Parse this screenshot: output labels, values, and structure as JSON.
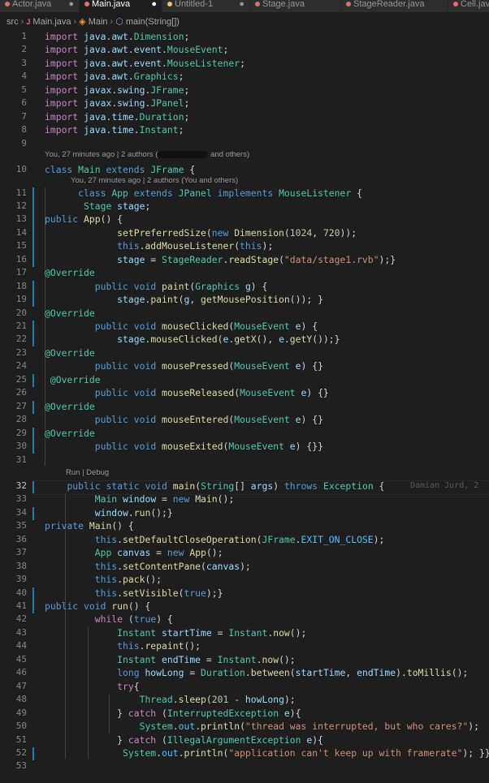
{
  "tabs": [
    {
      "label": "Actor.java",
      "modified": true,
      "active": false
    },
    {
      "label": "Main.java",
      "modified": true,
      "active": true
    },
    {
      "label": "Untitled-1",
      "modified": true,
      "active": false
    },
    {
      "label": "Stage.java",
      "modified": false,
      "active": false
    },
    {
      "label": "StageReader.java",
      "modified": false,
      "active": false
    },
    {
      "label": "Cell.java",
      "modified": false,
      "active": false
    }
  ],
  "breadcrumb": {
    "root": "src",
    "file": "Main.java",
    "class": "Main",
    "method": "main(String[])"
  },
  "lens": {
    "blame_main": "You, 27 minutes ago | 2 authors (",
    "blame_main_tail": " and others)",
    "blame_app": "You, 27 minutes ago | 2 authors (You and others)",
    "run_debug": "Run | Debug"
  },
  "inline_blame": "Damian Jurd, 2",
  "lines": [
    {
      "n": "1",
      "html": "<span class='kc'>import</span> <span class='v'>java</span>.<span class='v'>awt</span>.<span class='t'>Dimension</span>;"
    },
    {
      "n": "2",
      "html": "<span class='kc'>import</span> <span class='v'>java</span>.<span class='v'>awt</span>.<span class='v'>event</span>.<span class='t'>MouseEvent</span>;"
    },
    {
      "n": "3",
      "html": "<span class='kc'>import</span> <span class='v'>java</span>.<span class='v'>awt</span>.<span class='v'>event</span>.<span class='t'>MouseListener</span>;"
    },
    {
      "n": "4",
      "html": "<span class='kc'>import</span> <span class='v'>java</span>.<span class='v'>awt</span>.<span class='t'>Graphics</span>;"
    },
    {
      "n": "5",
      "html": "<span class='kc'>import</span> <span class='v'>javax</span>.<span class='v'>swing</span>.<span class='t'>JFrame</span>;"
    },
    {
      "n": "6",
      "html": "<span class='kc'>import</span> <span class='v'>javax</span>.<span class='v'>swing</span>.<span class='t'>JPanel</span>;"
    },
    {
      "n": "7",
      "html": "<span class='kc'>import</span> <span class='v'>java</span>.<span class='v'>time</span>.<span class='t'>Duration</span>;"
    },
    {
      "n": "8",
      "html": "<span class='kc'>import</span> <span class='v'>java</span>.<span class='v'>time</span>.<span class='t'>Instant</span>;"
    },
    {
      "n": "9",
      "html": ""
    },
    {
      "n": "10",
      "html": "<span class='k'>class</span> <span class='t'>Main</span> <span class='k'>extends</span> <span class='t'>JFrame</span> {"
    },
    {
      "n": "11",
      "html": "      <span class='k'>class</span> <span class='t'>App</span> <span class='k'>extends</span> <span class='t'>JPanel</span> <span class='k'>implements</span> <span class='t'>MouseListener</span> {"
    },
    {
      "n": "12",
      "html": "       <span class='t'>Stage</span> <span class='v'>stage</span>;"
    },
    {
      "n": "13",
      "html": "<span class='k'>public</span> <span class='f'>App</span>() {"
    },
    {
      "n": "14",
      "html": "             <span class='f'>setPreferredSize</span>(<span class='k'>new</span> <span class='f'>Dimension</span>(<span class='n'>1024</span>, <span class='n'>720</span>));"
    },
    {
      "n": "15",
      "html": "             <span class='k'>this</span>.<span class='f'>addMouseListener</span>(<span class='k'>this</span>);"
    },
    {
      "n": "16",
      "html": "             <span class='v'>stage</span> = <span class='t'>StageReader</span>.<span class='f'>readStage</span>(<span class='s'>\"data/stage1.rvb\"</span>);}"
    },
    {
      "n": "17",
      "html": "<span class='ann'>@Override</span>"
    },
    {
      "n": "18",
      "html": "         <span class='k'>public</span> <span class='k'>void</span> <span class='f'>paint</span>(<span class='t'>Graphics</span> <span class='v'>g</span>) {"
    },
    {
      "n": "19",
      "html": "             <span class='v'>stage</span>.<span class='f'>paint</span>(<span class='v'>g</span>, <span class='f'>getMousePosition</span>()); }"
    },
    {
      "n": "20",
      "html": "<span class='ann'>@Override</span>"
    },
    {
      "n": "21",
      "html": "         <span class='k'>public</span> <span class='k'>void</span> <span class='f'>mouseClicked</span>(<span class='t'>MouseEvent</span> <span class='v'>e</span>) {"
    },
    {
      "n": "22",
      "html": "             <span class='v'>stage</span>.<span class='f'>mouseClicked</span>(<span class='v'>e</span>.<span class='f'>getX</span>(), <span class='v'>e</span>.<span class='f'>getY</span>());}"
    },
    {
      "n": "23",
      "html": "<span class='ann'>@Override</span>"
    },
    {
      "n": "24",
      "html": "         <span class='k'>public</span> <span class='k'>void</span> <span class='f'>mousePressed</span>(<span class='t'>MouseEvent</span> <span class='v'>e</span>) {}"
    },
    {
      "n": "25",
      "html": " <span class='ann'>@Override</span>"
    },
    {
      "n": "26",
      "html": "         <span class='k'>public</span> <span class='k'>void</span> <span class='f'>mouseReleased</span>(<span class='t'>MouseEvent</span> <span class='v'>e</span>) {}"
    },
    {
      "n": "27",
      "html": "<span class='ann'>@Override</span>"
    },
    {
      "n": "28",
      "html": "         <span class='k'>public</span> <span class='k'>void</span> <span class='f'>mouseEntered</span>(<span class='t'>MouseEvent</span> <span class='v'>e</span>) {}"
    },
    {
      "n": "29",
      "html": "<span class='ann'>@Override</span>"
    },
    {
      "n": "30",
      "html": "         <span class='k'>public</span> <span class='k'>void</span> <span class='f'>mouseExited</span>(<span class='t'>MouseEvent</span> <span class='v'>e</span>) {}}"
    },
    {
      "n": "31",
      "html": ""
    },
    {
      "n": "32",
      "html": "    <span class='k'>public</span> <span class='k'>static</span> <span class='k'>void</span> <span class='f'>main</span>(<span class='t'>String</span>[] <span class='v'>args</span>) <span class='k'>throws</span> <span class='t'>Exception</span> {"
    },
    {
      "n": "33",
      "html": "         <span class='t'>Main</span> <span class='v'>window</span> = <span class='k'>new</span> <span class='f'>Main</span>();"
    },
    {
      "n": "34",
      "html": "         <span class='v'>window</span>.<span class='f'>run</span>();}"
    },
    {
      "n": "35",
      "html": "<span class='k'>private</span> <span class='f'>Main</span>() {"
    },
    {
      "n": "36",
      "html": "         <span class='k'>this</span>.<span class='f'>setDefaultCloseOperation</span>(<span class='t'>JFrame</span>.<span class='m'>EXIT_ON_CLOSE</span>);"
    },
    {
      "n": "37",
      "html": "         <span class='t'>App</span> <span class='v'>canvas</span> = <span class='k'>new</span> <span class='f'>App</span>();"
    },
    {
      "n": "38",
      "html": "         <span class='k'>this</span>.<span class='f'>setContentPane</span>(<span class='v'>canvas</span>);"
    },
    {
      "n": "39",
      "html": "         <span class='k'>this</span>.<span class='f'>pack</span>();"
    },
    {
      "n": "40",
      "html": "         <span class='k'>this</span>.<span class='f'>setVisible</span>(<span class='k'>true</span>);}"
    },
    {
      "n": "41",
      "html": "<span class='k'>public</span> <span class='k'>void</span> <span class='f'>run</span>() {"
    },
    {
      "n": "42",
      "html": "         <span class='kc'>while</span> (<span class='k'>true</span>) {"
    },
    {
      "n": "43",
      "html": "             <span class='t'>Instant</span> <span class='v'>startTime</span> = <span class='t'>Instant</span>.<span class='f'>now</span>();"
    },
    {
      "n": "44",
      "html": "             <span class='k'>this</span>.<span class='f'>repaint</span>();"
    },
    {
      "n": "45",
      "html": "             <span class='t'>Instant</span> <span class='v'>endTime</span> = <span class='t'>Instant</span>.<span class='f'>now</span>();"
    },
    {
      "n": "46",
      "html": "             <span class='k'>long</span> <span class='v'>howLong</span> = <span class='t'>Duration</span>.<span class='f'>between</span>(<span class='v'>startTime</span>, <span class='v'>endTime</span>).<span class='f'>toMillis</span>();"
    },
    {
      "n": "47",
      "html": "             <span class='kc'>try</span>{"
    },
    {
      "n": "48",
      "html": "                 <span class='t'>Thread</span>.<span class='f'>sleep</span>(<span class='n'>201</span> - <span class='v'>howLong</span>);"
    },
    {
      "n": "49",
      "html": "             } <span class='kc'>catch</span> (<span class='t'>InterruptedException</span> <span class='v'>e</span>){"
    },
    {
      "n": "50",
      "html": "                 <span class='t'>System</span>.<span class='m'>out</span>.<span class='f'>println</span>(<span class='s'>\"thread was interrupted, but who cares?\"</span>);"
    },
    {
      "n": "51",
      "html": "             } <span class='kc'>catch</span> (<span class='t'>IllegalArgumentException</span> <span class='v'>e</span>){"
    },
    {
      "n": "52",
      "html": "              <span class='t'>System</span>.<span class='m'>out</span>.<span class='f'>println</span>(<span class='s'>\"application can't keep up with framerate\"</span>); }}}}"
    },
    {
      "n": "53",
      "html": ""
    }
  ],
  "current_line": "32",
  "colors": {
    "bg": "#1e1e1e",
    "tab_bg": "#2d2d2d",
    "git_modified": "#1b81a8",
    "keyword": "#569cd6",
    "control": "#c586c0",
    "type": "#4ec9b0",
    "function": "#dcdcaa",
    "variable": "#9cdcfe",
    "string": "#ce9178",
    "number": "#b5cea8"
  }
}
